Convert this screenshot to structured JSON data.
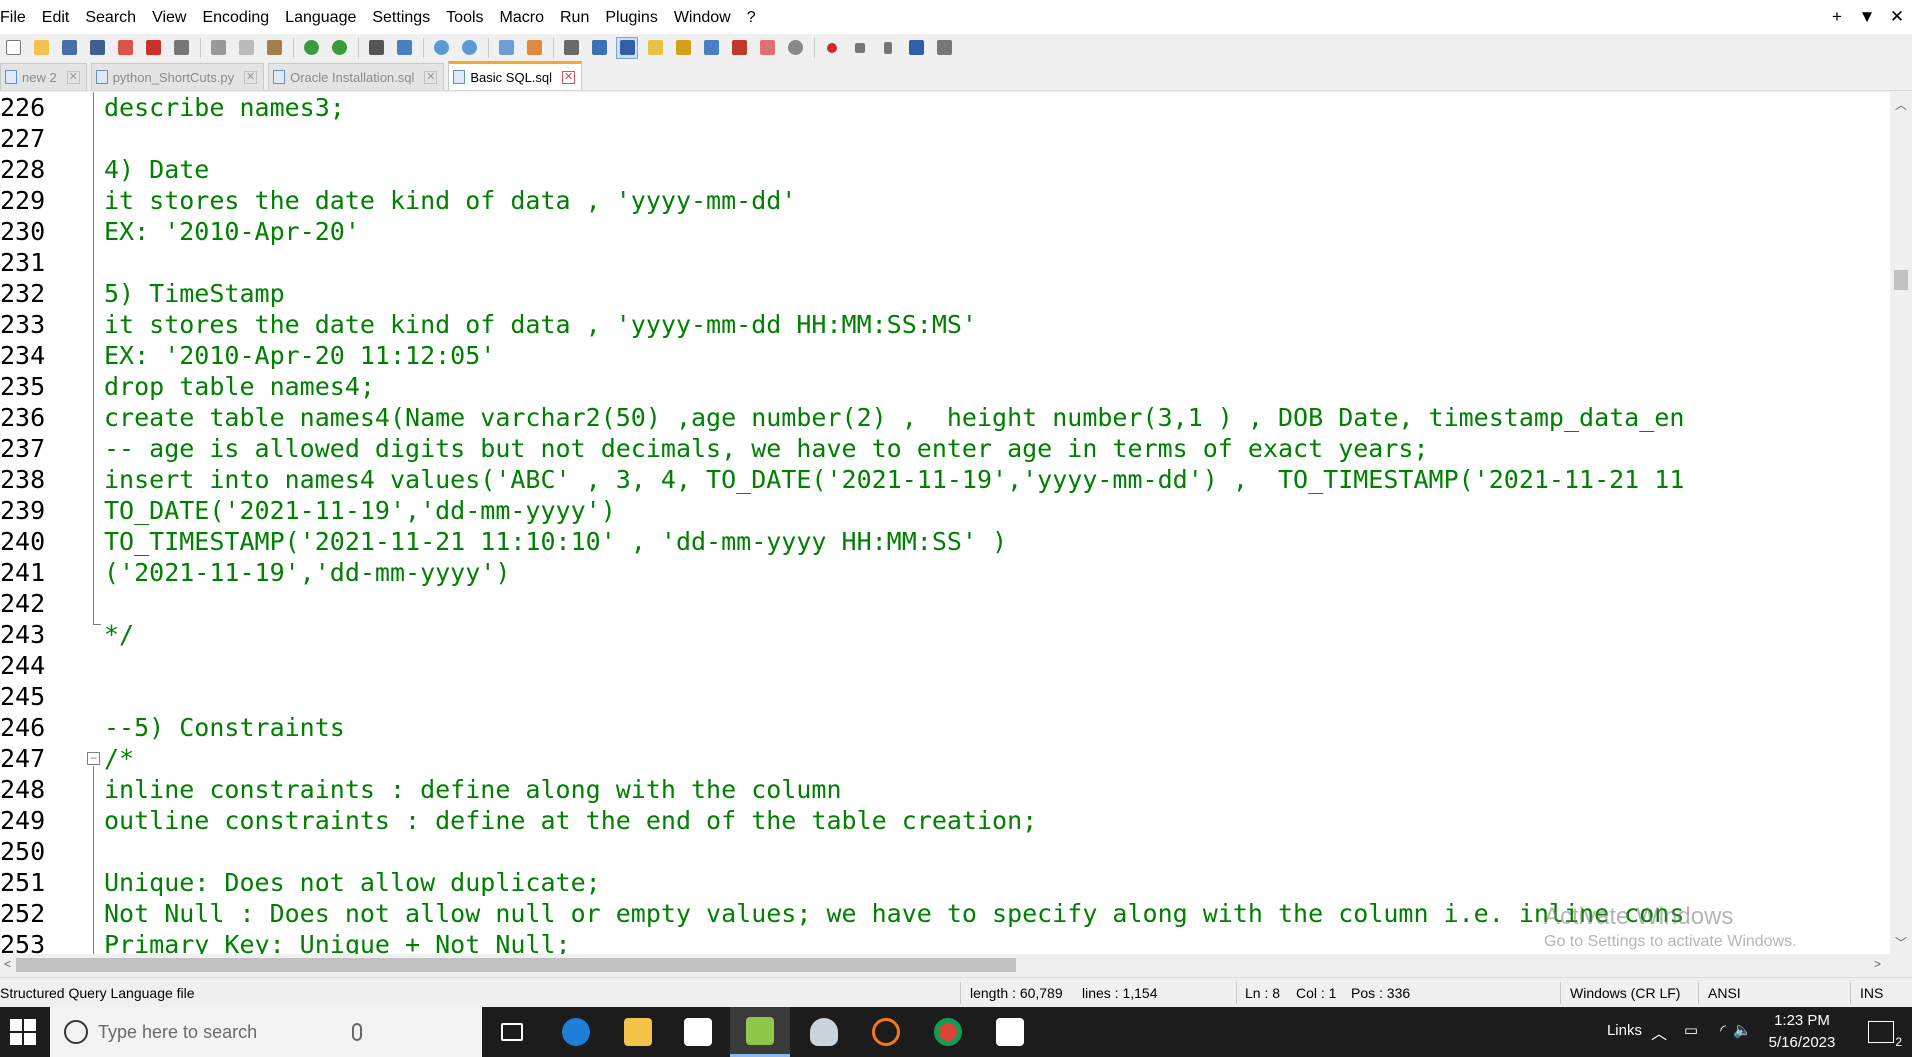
{
  "menu": [
    "File",
    "Edit",
    "Search",
    "View",
    "Encoding",
    "Language",
    "Settings",
    "Tools",
    "Macro",
    "Run",
    "Plugins",
    "Window",
    "?"
  ],
  "window_controls": [
    "+",
    "▼",
    "✕"
  ],
  "tabs": [
    {
      "label": "new 2",
      "active": false
    },
    {
      "label": "python_ShortCuts.py",
      "active": false
    },
    {
      "label": "Oracle Installation.sql",
      "active": false
    },
    {
      "label": "Basic SQL.sql",
      "active": true
    }
  ],
  "editor": {
    "lines": [
      {
        "n": "226",
        "text": "describe names3;"
      },
      {
        "n": "227",
        "text": ""
      },
      {
        "n": "228",
        "text": "4) Date"
      },
      {
        "n": "229",
        "text": "it stores the date kind of data , 'yyyy-mm-dd'"
      },
      {
        "n": "230",
        "text": "EX: '2010-Apr-20'"
      },
      {
        "n": "231",
        "text": ""
      },
      {
        "n": "232",
        "text": "5) TimeStamp"
      },
      {
        "n": "233",
        "text": "it stores the date kind of data , 'yyyy-mm-dd HH:MM:SS:MS'"
      },
      {
        "n": "234",
        "text": "EX: '2010-Apr-20 11:12:05'"
      },
      {
        "n": "235",
        "text": "drop table names4;"
      },
      {
        "n": "236",
        "text": "create table names4(Name varchar2(50) ,age number(2) ,  height number(3,1 ) , DOB Date, timestamp_data_en"
      },
      {
        "n": "237",
        "text": "-- age is allowed digits but not decimals, we have to enter age in terms of exact years;"
      },
      {
        "n": "238",
        "text": "insert into names4 values('ABC' , 3, 4, TO_DATE('2021-11-19','yyyy-mm-dd') ,  TO_TIMESTAMP('2021-11-21 11"
      },
      {
        "n": "239",
        "text": "TO_DATE('2021-11-19','dd-mm-yyyy')"
      },
      {
        "n": "240",
        "text": "TO_TIMESTAMP('2021-11-21 11:10:10' , 'dd-mm-yyyy HH:MM:SS' )"
      },
      {
        "n": "241",
        "text": "('2021-11-19','dd-mm-yyyy')"
      },
      {
        "n": "242",
        "text": ""
      },
      {
        "n": "243",
        "text": "*/"
      },
      {
        "n": "244",
        "text": ""
      },
      {
        "n": "245",
        "text": ""
      },
      {
        "n": "246",
        "text": "--5) Constraints"
      },
      {
        "n": "247",
        "text": "/*"
      },
      {
        "n": "248",
        "text": "inline constraints : define along with the column"
      },
      {
        "n": "249",
        "text": "outline constraints : define at the end of the table creation;"
      },
      {
        "n": "250",
        "text": ""
      },
      {
        "n": "251",
        "text": "Unique: Does not allow duplicate;"
      },
      {
        "n": "252",
        "text": "Not Null : Does not allow null or empty values; we have to specify along with the column i.e. inline cons"
      },
      {
        "n": "253",
        "text": "Primary Key: Unique + Not Null;"
      }
    ]
  },
  "status": {
    "file_type": "Structured Query Language file",
    "length": "length : 60,789",
    "lines": "lines : 1,154",
    "ln": "Ln : 8",
    "col": "Col : 1",
    "pos": "Pos : 336",
    "eol": "Windows (CR LF)",
    "encoding": "ANSI",
    "mode": "INS"
  },
  "watermark": {
    "title": "Activate Windows",
    "subtitle": "Go to Settings to activate Windows."
  },
  "taskbar": {
    "search_placeholder": "Type here to search",
    "links": "Links",
    "time": "1:23 PM",
    "date": "5/16/2023",
    "notifications": "2"
  },
  "colors": {
    "code": "#008000",
    "tab_active_accent": "#f9a825",
    "taskbar": "#1c1c1c"
  }
}
